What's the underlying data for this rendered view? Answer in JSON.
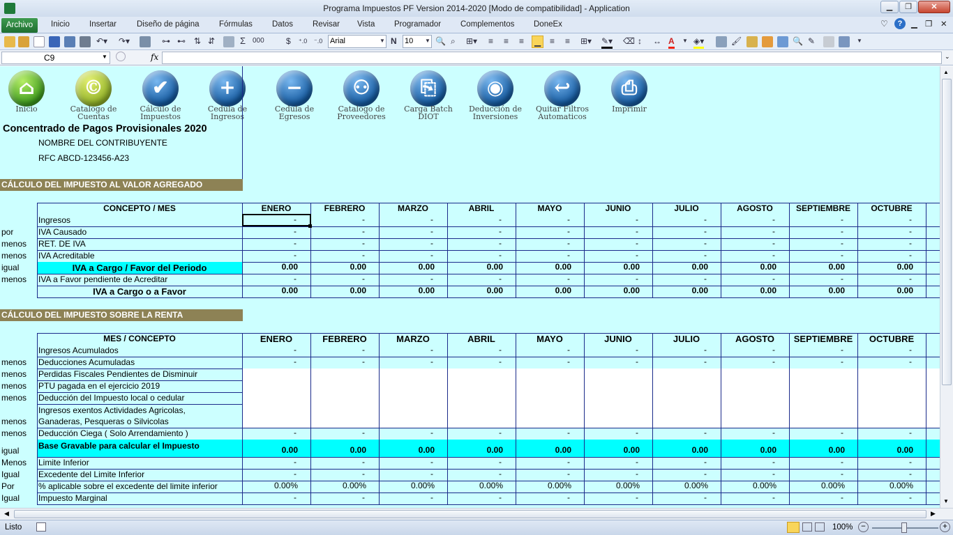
{
  "window": {
    "title": "Programa Impuestos PF Version 2014-2020  [Modo de compatibilidad]  -  Application"
  },
  "menu": {
    "file": "Archivo",
    "items": [
      "Inicio",
      "Insertar",
      "Diseño de página",
      "Fórmulas",
      "Datos",
      "Revisar",
      "Vista",
      "Programador",
      "Complementos",
      "DoneEx"
    ]
  },
  "toolbar": {
    "font_name": "Arial",
    "font_size": "10",
    "bold_label": "N"
  },
  "formula_bar": {
    "cell_ref": "C9",
    "fx": "fx",
    "value": ""
  },
  "nav_buttons": [
    {
      "label": "Inicio",
      "icon": "home-icon"
    },
    {
      "label": "Catalogo de Cuentas",
      "icon": "copyright-icon"
    },
    {
      "label": "Cálculo de Impuestos",
      "icon": "checkmark-icon"
    },
    {
      "label": "Cedula de Ingresos",
      "icon": "plus-icon"
    },
    {
      "label": "Cedula de Egresos",
      "icon": "minus-icon"
    },
    {
      "label": "Catalogo de Proveedores",
      "icon": "people-icon"
    },
    {
      "label": "Carga Batch DIOT",
      "icon": "disk-icon"
    },
    {
      "label": "Deducción de Inversiones",
      "icon": "camera-icon"
    },
    {
      "label": "Quitar Filtros Automaticos",
      "icon": "undo-arrow-icon"
    },
    {
      "label": "Imprimir",
      "icon": "printer-icon"
    }
  ],
  "header": {
    "title": "Concentrado de Pagos Provisionales 2020",
    "contribuyente": "NOMBRE DEL CONTRIBUYENTE",
    "rfc": "RFC ABCD-123456-A23"
  },
  "months": [
    "ENERO",
    "FEBRERO",
    "MARZO",
    "ABRIL",
    "MAYO",
    "JUNIO",
    "JULIO",
    "AGOSTO",
    "SEPTIEMBRE",
    "OCTUBRE",
    "N"
  ],
  "iva": {
    "section_title": "CÁLCULO DEL IMPUESTO AL VALOR AGREGADO",
    "header_label": "CONCEPTO / MES",
    "rows": [
      {
        "op": "",
        "label": "Ingresos",
        "value": "-"
      },
      {
        "op": "por",
        "label": "IVA Causado",
        "value": "-"
      },
      {
        "op": "menos",
        "label": "RET. DE IVA",
        "value": "-"
      },
      {
        "op": "menos",
        "label": "IVA Acreditable",
        "value": "-"
      },
      {
        "op": "igual",
        "label": "IVA a Cargo / Favor del Periodo",
        "value": "0.00"
      },
      {
        "op": "menos",
        "label": "IVA a Favor pendiente de Acreditar",
        "value": "-"
      },
      {
        "op": "",
        "label": "IVA a Cargo o a Favor",
        "value": "0.00"
      }
    ]
  },
  "isr": {
    "section_title": "CÁLCULO DEL IMPUESTO SOBRE LA RENTA",
    "header_label": "MES / CONCEPTO",
    "rows": [
      {
        "op": "",
        "label": "Ingresos Acumulados",
        "value": "-"
      },
      {
        "op": "menos",
        "label": "Deducciones Acumuladas",
        "value": "-"
      },
      {
        "op": "menos",
        "label": "Perdidas Fiscales Pendientes de Disminuir",
        "value": ""
      },
      {
        "op": "menos",
        "label": "PTU pagada en el ejercicio 2019",
        "value": ""
      },
      {
        "op": "menos",
        "label": "Deducción del Impuesto local o cedular",
        "value": ""
      },
      {
        "op": "menos",
        "label": "Ingresos exentos Actividades Agricolas,",
        "label2": "Ganaderas, Pesqueras o Silvicolas",
        "value": ""
      },
      {
        "op": "menos",
        "label": "Deducción Ciega ( Solo Arrendamiento )",
        "value": "-"
      },
      {
        "op": "igual",
        "label": "Base Gravable para calcular el Impuesto",
        "value": "0.00"
      },
      {
        "op": "Menos",
        "label": "Limite Inferior",
        "value": "-"
      },
      {
        "op": "Igual",
        "label": "Excedente del Limite Inferior",
        "value": "-"
      },
      {
        "op": "Por",
        "label": "% aplicable sobre el excedente del limite inferior",
        "value": "0.00%"
      },
      {
        "op": "Igual",
        "label": "Impuesto Marginal",
        "value": "-"
      }
    ]
  },
  "status": {
    "ready": "Listo",
    "zoom": "100%"
  },
  "colors": {
    "sheet_bg": "#ccffff",
    "highlight_row": "#00ffff",
    "section_bar": "#8d8255",
    "grid": "#1a2a8a"
  }
}
